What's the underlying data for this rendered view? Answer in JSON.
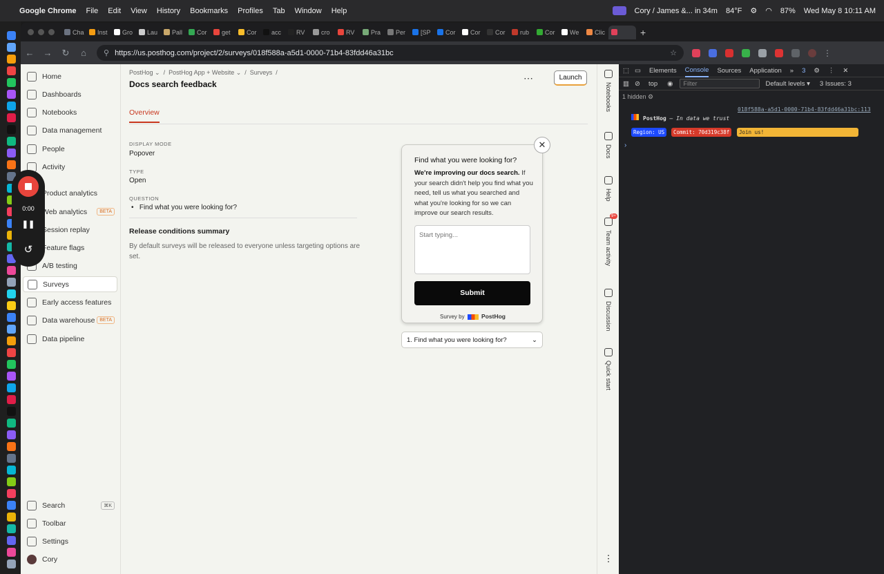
{
  "menubar": {
    "app": "Google Chrome",
    "items": [
      "File",
      "Edit",
      "View",
      "History",
      "Bookmarks",
      "Profiles",
      "Tab",
      "Window",
      "Help"
    ],
    "event": "Cory / James &... in 34m",
    "temperature": "84°F",
    "battery": "87%",
    "clock": "Wed May 8  10:11 AM"
  },
  "tabs": [
    "Cha",
    "Inst",
    "Gro",
    "Lau",
    "Pall",
    "Cor",
    "get",
    "Cor",
    "acc",
    "RV",
    "cro",
    "RV",
    "Pra",
    "Per",
    "[SP",
    "Cor",
    "Cor",
    "Cor",
    "rub",
    "Cor",
    "We",
    "Clic",
    ""
  ],
  "address": {
    "url": "https://us.posthog.com/project/2/surveys/018f588a-a5d1-0000-71b4-83fdd46a31bc"
  },
  "sidebar": {
    "items": [
      {
        "label": "Home",
        "beta": ""
      },
      {
        "label": "Dashboards",
        "beta": ""
      },
      {
        "label": "Notebooks",
        "beta": ""
      },
      {
        "label": "Data management",
        "beta": ""
      },
      {
        "label": "People",
        "beta": ""
      },
      {
        "label": "Activity",
        "beta": ""
      },
      {
        "label": "Product analytics",
        "beta": ""
      },
      {
        "label": "Web analytics",
        "beta": "BETA"
      },
      {
        "label": "Session replay",
        "beta": ""
      },
      {
        "label": "Feature flags",
        "beta": ""
      },
      {
        "label": "A/B testing",
        "beta": ""
      },
      {
        "label": "Surveys",
        "beta": ""
      },
      {
        "label": "Early access features",
        "beta": ""
      },
      {
        "label": "Data warehouse",
        "beta": "BETA"
      },
      {
        "label": "Data pipeline",
        "beta": ""
      }
    ],
    "bottom": [
      {
        "label": "Search",
        "shortcut": "⌘K"
      },
      {
        "label": "Toolbar",
        "shortcut": ""
      },
      {
        "label": "Settings",
        "shortcut": ""
      },
      {
        "label": "Cory",
        "shortcut": ""
      }
    ]
  },
  "recorder": {
    "time": "0:00"
  },
  "breadcrumb": {
    "org": "PostHog",
    "project": "PostHog App + Website",
    "section": "Surveys"
  },
  "page": {
    "title": "Docs search feedback",
    "launch": "Launch",
    "tab": "Overview"
  },
  "fields": {
    "display_mode_label": "DISPLAY MODE",
    "display_mode": "Popover",
    "type_label": "TYPE",
    "type": "Open",
    "question_label": "QUESTION",
    "question": "Find what you were looking for?",
    "release_title": "Release conditions summary",
    "release_desc": "By default surveys will be released to everyone unless targeting options are set."
  },
  "popup": {
    "question": "Find what you were looking for?",
    "desc_bold": "We're improving our docs search.",
    "desc_rest": " If your search didn't help you find what you need, tell us what you searched and what you're looking for so we can improve our search results.",
    "placeholder": "Start typing...",
    "submit": "Submit",
    "footer_prefix": "Survey by",
    "footer_brand": "PostHog",
    "question_select": "1. Find what you were looking for?"
  },
  "rail": [
    "Notebooks",
    "Docs",
    "Help",
    "Team activity",
    "Discussion",
    "Quick start"
  ],
  "rail_badge": "9+",
  "devtools": {
    "tabs": [
      "Elements",
      "Console",
      "Sources",
      "Application"
    ],
    "issues_count": "3",
    "context": "top",
    "filter_placeholder": "Filter",
    "levels": "Default levels ▾",
    "issues": "3 Issues:  3",
    "hidden": "1 hidden",
    "log_source": "018f588a-a5d1-0000-71b4-83fdd46a31bc:113",
    "log_brand": "PostHog",
    "log_tagline": "— In data we trust",
    "region": "Region: US",
    "commit": "Commit: 70d319c38f",
    "join": "Join us!"
  },
  "colors": {
    "accent": "#c8361e",
    "launch_border": "#e9a13b",
    "devtools_link": "#8ab4f8"
  }
}
